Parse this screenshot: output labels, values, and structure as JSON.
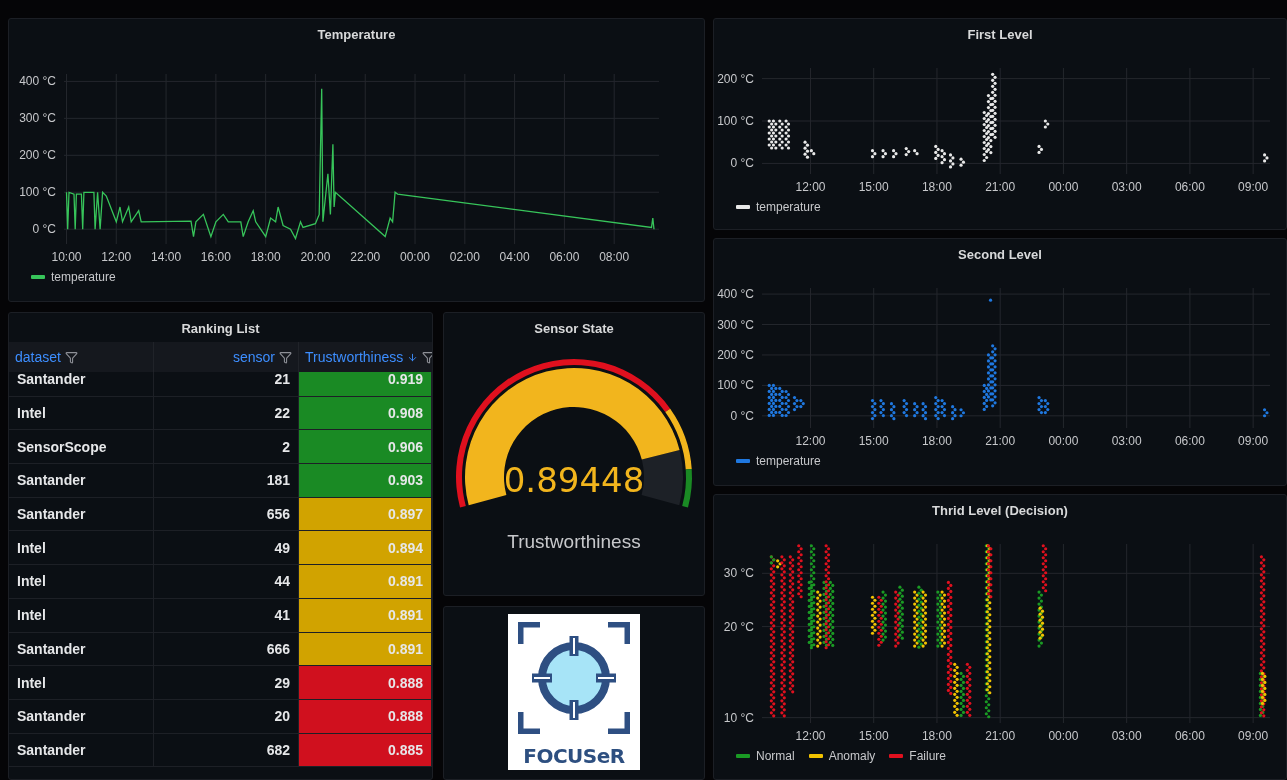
{
  "panels": {
    "temperature": {
      "title": "Temperature",
      "chart_data": {
        "type": "line",
        "grid": true,
        "xlim": [
          "2000-01-01T09:54",
          "2000-01-02T09:48"
        ],
        "ylim": [
          -40,
          420
        ],
        "yticks": [
          {
            "value": 0,
            "label": "0 °C"
          },
          {
            "value": 100,
            "label": "100 °C"
          },
          {
            "value": 200,
            "label": "200 °C"
          },
          {
            "value": 300,
            "label": "300 °C"
          },
          {
            "value": 400,
            "label": "400 °C"
          }
        ],
        "xticks": [
          {
            "value": "2000-01-01T10:00",
            "label": "10:00"
          },
          {
            "value": "2000-01-01T12:00",
            "label": "12:00"
          },
          {
            "value": "2000-01-01T14:00",
            "label": "14:00"
          },
          {
            "value": "2000-01-01T16:00",
            "label": "16:00"
          },
          {
            "value": "2000-01-01T18:00",
            "label": "18:00"
          },
          {
            "value": "2000-01-01T20:00",
            "label": "20:00"
          },
          {
            "value": "2000-01-01T22:00",
            "label": "22:00"
          },
          {
            "value": "2000-01-02T00:00",
            "label": "00:00"
          },
          {
            "value": "2000-01-02T02:00",
            "label": "02:00"
          },
          {
            "value": "2000-01-02T04:00",
            "label": "04:00"
          },
          {
            "value": "2000-01-02T06:00",
            "label": "06:00"
          },
          {
            "value": "2000-01-02T08:00",
            "label": "08:00"
          }
        ],
        "x": [
          "2000-01-01T10:00",
          "2000-01-01T10:03",
          "2000-01-01T10:06",
          "2000-01-01T10:18",
          "2000-01-01T10:21",
          "2000-01-01T10:24",
          "2000-01-01T10:36",
          "2000-01-01T10:39",
          "2000-01-01T10:42",
          "2000-01-01T11:06",
          "2000-01-01T11:09",
          "2000-01-01T11:15",
          "2000-01-01T11:21",
          "2000-01-01T11:27",
          "2000-01-01T11:36",
          "2000-01-01T12:00",
          "2000-01-01T12:09",
          "2000-01-01T12:15",
          "2000-01-01T12:30",
          "2000-01-01T12:36",
          "2000-01-01T12:54",
          "2000-01-01T13:00",
          "2000-01-01T15:00",
          "2000-01-01T15:06",
          "2000-01-01T15:12",
          "2000-01-01T15:30",
          "2000-01-01T15:48",
          "2000-01-01T16:00",
          "2000-01-01T16:18",
          "2000-01-01T16:30",
          "2000-01-01T17:00",
          "2000-01-01T17:06",
          "2000-01-01T17:18",
          "2000-01-01T17:30",
          "2000-01-01T17:36",
          "2000-01-01T18:00",
          "2000-01-01T18:12",
          "2000-01-01T18:24",
          "2000-01-01T18:30",
          "2000-01-01T18:42",
          "2000-01-01T19:00",
          "2000-01-01T19:12",
          "2000-01-01T19:24",
          "2000-01-01T19:30",
          "2000-01-01T20:00",
          "2000-01-01T20:09",
          "2000-01-01T20:15",
          "2000-01-01T20:18",
          "2000-01-01T20:30",
          "2000-01-01T20:36",
          "2000-01-01T20:42",
          "2000-01-01T20:45",
          "2000-01-01T20:48",
          "2000-01-01T22:48",
          "2000-01-01T23:00",
          "2000-01-01T23:06",
          "2000-01-01T23:12",
          "2000-01-01T23:18",
          "2000-01-02T09:30",
          "2000-01-02T09:33",
          "2000-01-02T09:36"
        ],
        "series": [
          {
            "name": "temperature",
            "color": "#37c45a",
            "values": [
              100,
              0,
              100,
              95,
              0,
              95,
              95,
              0,
              100,
              100,
              0,
              100,
              0,
              100,
              90,
              20,
              60,
              20,
              60,
              20,
              50,
              20,
              22,
              -20,
              20,
              40,
              -20,
              20,
              40,
              20,
              20,
              -20,
              20,
              50,
              20,
              -20,
              30,
              20,
              60,
              10,
              0,
              -25,
              20,
              5,
              15,
              40,
              380,
              20,
              150,
              40,
              230,
              60,
              100,
              -20,
              30,
              20,
              100,
              95,
              5,
              30,
              0
            ]
          }
        ]
      }
    },
    "first_level": {
      "title": "First Level",
      "y_ticks": [
        "200 °C",
        "100 °C",
        "0 °C"
      ],
      "x_ticks": [
        "12:00",
        "15:00",
        "18:00",
        "21:00",
        "00:00",
        "03:00",
        "06:00",
        "09:00"
      ],
      "legend": [
        {
          "label": "temperature",
          "color": "#e8e8e8"
        }
      ]
    },
    "ranking": {
      "title": "Ranking List",
      "columns": [
        {
          "label": "dataset",
          "sorted": false
        },
        {
          "label": "sensor",
          "sorted": false
        },
        {
          "label": "Trustworthiness",
          "sorted": true
        }
      ],
      "rows": [
        {
          "dataset": "Santander",
          "sensor": "21",
          "trust": "0.919",
          "color": "#1a8a24"
        },
        {
          "dataset": "Intel",
          "sensor": "22",
          "trust": "0.908",
          "color": "#1a8a24"
        },
        {
          "dataset": "SensorScope",
          "sensor": "2",
          "trust": "0.906",
          "color": "#1a8a24"
        },
        {
          "dataset": "Santander",
          "sensor": "181",
          "trust": "0.903",
          "color": "#1a8a24"
        },
        {
          "dataset": "Santander",
          "sensor": "656",
          "trust": "0.897",
          "color": "#d1a300"
        },
        {
          "dataset": "Intel",
          "sensor": "49",
          "trust": "0.894",
          "color": "#d1a300"
        },
        {
          "dataset": "Intel",
          "sensor": "44",
          "trust": "0.891",
          "color": "#d1a300"
        },
        {
          "dataset": "Intel",
          "sensor": "41",
          "trust": "0.891",
          "color": "#d1a300"
        },
        {
          "dataset": "Santander",
          "sensor": "666",
          "trust": "0.891",
          "color": "#d1a300"
        },
        {
          "dataset": "Intel",
          "sensor": "29",
          "trust": "0.888",
          "color": "#d0101e"
        },
        {
          "dataset": "Santander",
          "sensor": "20",
          "trust": "0.888",
          "color": "#d0101e"
        },
        {
          "dataset": "Santander",
          "sensor": "682",
          "trust": "0.885",
          "color": "#d0101e"
        }
      ]
    },
    "second_level": {
      "title": "Second Level",
      "y_ticks": [
        "400 °C",
        "300 °C",
        "200 °C",
        "100 °C",
        "0 °C"
      ],
      "x_ticks": [
        "12:00",
        "15:00",
        "18:00",
        "21:00",
        "00:00",
        "03:00",
        "06:00",
        "09:00"
      ],
      "legend": [
        {
          "label": "temperature",
          "color": "#1f78e0"
        }
      ]
    },
    "sensor_state": {
      "title": "Sensor State",
      "value": "0.89448",
      "label": "Trustworthiness"
    },
    "logo": {
      "text": "FOCUSeR"
    },
    "third_level": {
      "title": "Thrid Level (Decision)",
      "y_ticks": [
        "30 °C",
        "20 °C",
        "10 °C"
      ],
      "x_ticks": [
        "12:00",
        "15:00",
        "18:00",
        "21:00",
        "00:00",
        "03:00",
        "06:00",
        "09:00"
      ],
      "legend": [
        {
          "label": "Normal",
          "color": "#1a9a24"
        },
        {
          "label": "Anomaly",
          "color": "#f2c200"
        },
        {
          "label": "Failure",
          "color": "#e0101e"
        }
      ]
    }
  }
}
